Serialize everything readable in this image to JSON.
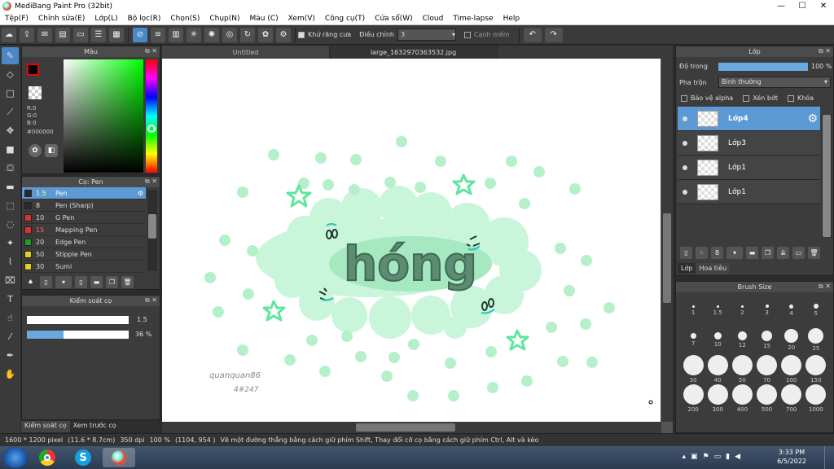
{
  "window": {
    "title": "MediBang Paint Pro (32bit)"
  },
  "menu": [
    "Tệp(F)",
    "Chỉnh sửa(E)",
    "Lớp(L)",
    "Bộ lọc(R)",
    "Chọn(S)",
    "Chụp(N)",
    "Màu (C)",
    "Xem(V)",
    "Công cụ(T)",
    "Cửa sổ(W)",
    "Cloud",
    "Time-lapse",
    "Help"
  ],
  "toolbar": {
    "antialias_label": "Khử răng cưa",
    "correction_label": "Điều chỉnh",
    "correction_value": "3",
    "smooth_label": "Cạnh mềm"
  },
  "color_panel": {
    "title": "Màu",
    "rgb": "R:0\nG:0\nB:0",
    "hex": "#000000",
    "fg_color": "#000000",
    "bg_color": "#ffffff"
  },
  "brush_panel": {
    "title": "Cọ: Pen",
    "items": [
      {
        "size": "1.5",
        "name": "Pen",
        "color": "#2a2a2a"
      },
      {
        "size": "8",
        "name": "Pen (Sharp)",
        "color": "#2a2a2a"
      },
      {
        "size": "10",
        "name": "G Pen",
        "color": "#e03030"
      },
      {
        "size": "15",
        "name": "Mapping Pen",
        "color": "#e03030"
      },
      {
        "size": "20",
        "name": "Edge Pen",
        "color": "#20a020"
      },
      {
        "size": "50",
        "name": "Stipple Pen",
        "color": "#e0d020"
      },
      {
        "size": "30",
        "name": "Sumi",
        "color": "#e0d020"
      }
    ]
  },
  "brush_control": {
    "title": "Kiểm soát cọ",
    "size_value": "1.5",
    "opacity_value": "36 %",
    "opacity_fraction": 0.36
  },
  "left_tabs": [
    "Kiểm soát cọ",
    "Xem trước cọ"
  ],
  "canvas_tabs": [
    "Untitled",
    "large_1632970363532.jpg"
  ],
  "canvas_art": {
    "word": "hóng",
    "signature": "quanquan86",
    "signature2": "4#247"
  },
  "layer_panel": {
    "title": "Lớp",
    "opacity_label": "Độ trong",
    "opacity_value": "100 %",
    "blend_label": "Pha trộn",
    "blend_value": "Bình thường",
    "protect_alpha": "Bảo vệ alpha",
    "clip": "Xén bớt",
    "lock": "Khóa",
    "layers": [
      "Lớp4",
      "Lớp3",
      "Lớp1",
      "Lớp1"
    ],
    "tabs": [
      "Lớp",
      "Hoa tiêu"
    ]
  },
  "brush_size_panel": {
    "title": "Brush Size",
    "sizes": [
      "1",
      "1.5",
      "2",
      "3",
      "4",
      "5",
      "7",
      "10",
      "12",
      "15",
      "20",
      "25",
      "30",
      "40",
      "50",
      "70",
      "100",
      "150",
      "200",
      "300",
      "400",
      "500",
      "700",
      "1000"
    ]
  },
  "status": {
    "dimensions": "1600 * 1200 pixel",
    "cm": "(11.6 * 8.7cm)",
    "dpi": "350 dpi",
    "zoom": "100 %",
    "coords": "(1104, 954 )",
    "hint": "Vẽ một đường thẳng bằng cách giữ phím Shift, Thay đổi cỡ cọ bằng cách giữ phím Ctrl, Alt và kéo"
  },
  "taskbar": {
    "time": "3:33 PM",
    "date": "6/5/2022"
  },
  "colors": {
    "accent": "#4a88c8",
    "mint": "#c8f5da",
    "dot": "#b8f0cc",
    "word": "#5a8a70",
    "teal": "#27c4b4"
  }
}
